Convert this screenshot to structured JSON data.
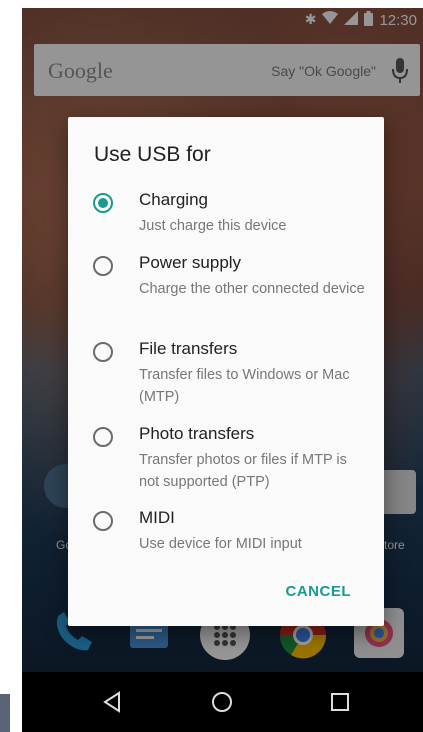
{
  "status_bar": {
    "time": "12:30"
  },
  "search_bar": {
    "logo": "Google",
    "hint": "Say \"Ok Google\""
  },
  "home": {
    "left_label": "Go",
    "right_label": "tore"
  },
  "dialog": {
    "title": "Use USB for",
    "options": [
      {
        "title": "Charging",
        "description": "Just charge this device",
        "selected": true
      },
      {
        "title": "Power supply",
        "description": "Charge the other connected device",
        "selected": false
      },
      {
        "title": "File transfers",
        "description": "Transfer files to Windows or Mac (MTP)",
        "selected": false
      },
      {
        "title": "Photo transfers",
        "description": "Transfer photos or files if MTP is not supported (PTP)",
        "selected": false
      },
      {
        "title": "MIDI",
        "description": "Use device for MIDI input",
        "selected": false
      }
    ],
    "cancel_label": "CANCEL"
  },
  "colors": {
    "accent": "#1a9a8e",
    "dialog_bg": "#fafafa",
    "nav_bar": "#000000"
  },
  "icons": [
    "bluetooth-icon",
    "wifi-icon",
    "signal-icon",
    "battery-icon",
    "mic-icon",
    "phone-icon",
    "messages-icon",
    "apps-icon",
    "chrome-icon",
    "camera-icon",
    "back-icon",
    "home-icon",
    "recents-icon"
  ]
}
